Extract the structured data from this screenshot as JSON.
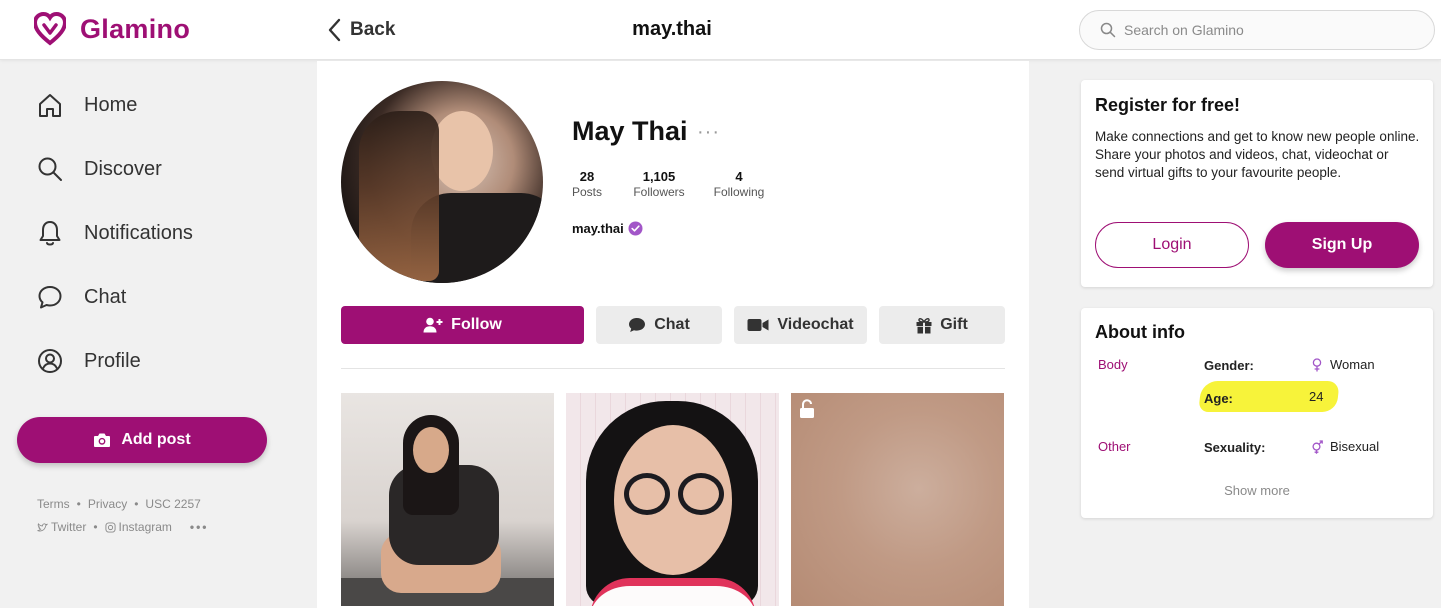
{
  "header": {
    "brand": "Glamino",
    "back_label": "Back",
    "title": "may.thai",
    "search_placeholder": "Search on Glamino"
  },
  "nav": {
    "items": [
      {
        "label": "Home",
        "icon": "home-icon"
      },
      {
        "label": "Discover",
        "icon": "search-icon"
      },
      {
        "label": "Notifications",
        "icon": "bell-icon"
      },
      {
        "label": "Chat",
        "icon": "chat-bubble-icon"
      },
      {
        "label": "Profile",
        "icon": "user-circle-icon"
      }
    ],
    "add_post_label": "Add post",
    "footer": {
      "terms": "Terms",
      "privacy": "Privacy",
      "usc": "USC 2257",
      "twitter": "Twitter",
      "instagram": "Instagram",
      "more": "•••"
    }
  },
  "profile": {
    "name": "May Thai",
    "username": "may.thai",
    "menu_dots": "···",
    "stats": {
      "posts": {
        "value": "28",
        "label": "Posts"
      },
      "followers": {
        "value": "1,105",
        "label": "Followers"
      },
      "following": {
        "value": "4",
        "label": "Following"
      }
    },
    "actions": {
      "follow": "Follow",
      "chat": "Chat",
      "videochat": "Videochat",
      "gift": "Gift"
    }
  },
  "register": {
    "title": "Register for free!",
    "text": "Make connections and get to know new people online. Share your photos and videos, chat, videochat or send virtual gifts to your favourite people.",
    "login_label": "Login",
    "signup_label": "Sign Up"
  },
  "about": {
    "title": "About info",
    "body_label": "Body",
    "other_label": "Other",
    "gender_key": "Gender:",
    "gender_value": "Woman",
    "age_key": "Age:",
    "age_value": "24",
    "sexuality_key": "Sexuality:",
    "sexuality_value": "Bisexual",
    "show_more": "Show more"
  },
  "colors": {
    "brand": "#9e0f74",
    "highlight": "#f7f33a",
    "verified": "#a256c8"
  }
}
